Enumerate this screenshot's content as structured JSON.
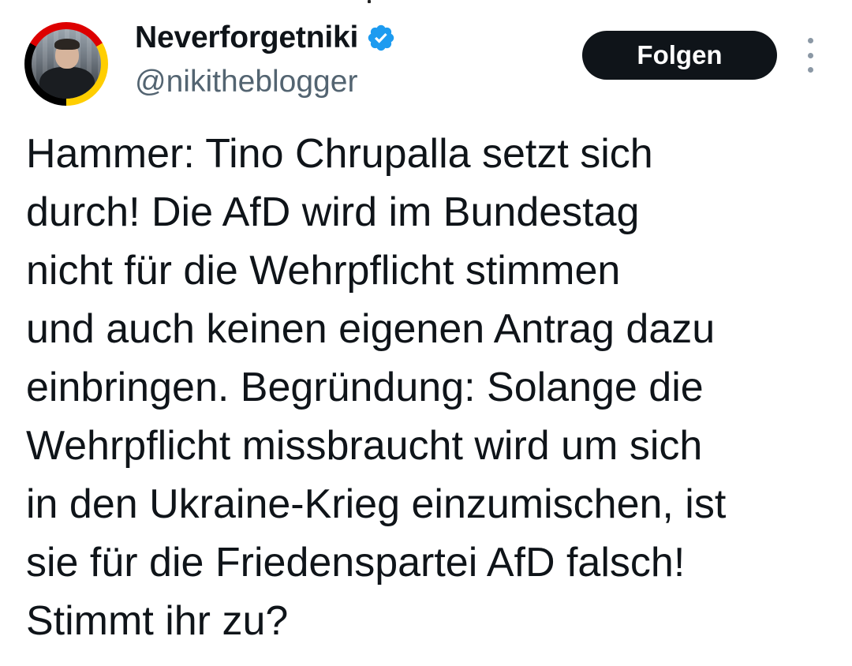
{
  "tweet": {
    "author": {
      "display_name": "Neverforgetniki",
      "handle": "@nikitheblogger",
      "verified": true,
      "verified_icon": "verified-badge-icon",
      "verified_color": "#1d9bf0",
      "avatar_ring_colors": [
        "#000000",
        "#dd0000",
        "#ffce00"
      ]
    },
    "follow_label": "Folgen",
    "more_icon": "more-vertical-icon",
    "text": "Hammer: Tino Chrupalla setzt sich\ndurch! Die AfD wird im Bundestag\nnicht für die Wehrpflicht stimmen\nund auch keinen eigenen Antrag dazu\neinbringen. Begründung: Solange die\nWehrpflicht missbraucht wird um sich\nin den Ukraine-Krieg einzumischen, ist\nsie für die Friedenspartei AfD falsch!\nStimmt ihr zu?"
  },
  "colors": {
    "text_primary": "#0f1419",
    "text_secondary": "#536471",
    "button_bg": "#0f1419",
    "button_text": "#ffffff",
    "icon_muted": "#8b98a5",
    "background": "#ffffff"
  }
}
